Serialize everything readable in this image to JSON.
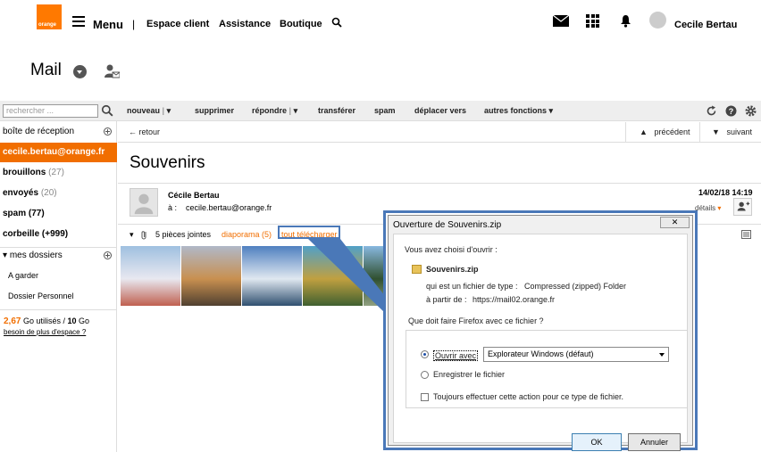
{
  "header": {
    "logo_text": "orange",
    "menu_label": "Menu",
    "nav": [
      "Espace client",
      "Assistance",
      "Boutique"
    ],
    "user_name": "Cecile Bertau"
  },
  "page": {
    "title": "Mail"
  },
  "toolbar": {
    "search_placeholder": "rechercher ...",
    "actions": [
      "nouveau",
      "supprimer",
      "répondre",
      "transférer",
      "spam",
      "déplacer vers",
      "autres fonctions"
    ]
  },
  "sidebar": {
    "inbox_header": "boîte de réception",
    "account": "cecile.bertau@orange.fr",
    "folders": [
      {
        "label": "brouillons",
        "count": "(27)"
      },
      {
        "label": "envoyés",
        "count": "(20)"
      },
      {
        "label": "spam",
        "count": "(77)"
      },
      {
        "label": "corbeille",
        "count": "(+999)"
      }
    ],
    "my_folders_header": "mes dossiers",
    "my_folders": [
      "A garder",
      "Dossier Personnel"
    ],
    "storage_used": "2,67",
    "storage_text": " Go utilisés / ",
    "storage_total": "10",
    "storage_unit": " Go",
    "storage_link": "besoin de plus d'espace ?"
  },
  "subbar": {
    "back": "retour",
    "previous": "précédent",
    "next": "suivant"
  },
  "mail": {
    "subject": "Souvenirs",
    "sender": "Cécile Bertau",
    "to_label": "à :",
    "to": "cecile.bertau@orange.fr",
    "date": "14/02/18 14:19",
    "details": "détails",
    "attachments_count": "5 pièces jointes",
    "slideshow": "diaporama (5)",
    "download_all": "tout télécharger"
  },
  "thumbnails": [
    {
      "name": "winter-mountain",
      "colors": [
        "#9fc0e0",
        "#e8e8f0",
        "#c06050"
      ]
    },
    {
      "name": "mountain-lake",
      "colors": [
        "#b0b8c8",
        "#c89050",
        "#504030"
      ]
    },
    {
      "name": "coast-cliffs",
      "colors": [
        "#4f80c0",
        "#e0e8f0",
        "#305070"
      ]
    },
    {
      "name": "wetland",
      "colors": [
        "#50a0c8",
        "#c0a040",
        "#406030"
      ]
    },
    {
      "name": "forest-lake",
      "colors": [
        "#88b8e0",
        "#305030",
        "#90a080"
      ]
    }
  ],
  "dialog": {
    "title": "Ouverture de Souvenirs.zip",
    "close": "✕",
    "intro": "Vous avez choisi d'ouvrir :",
    "filename": "Souvenirs.zip",
    "type_label": "qui est un fichier de type :",
    "type_value": "Compressed (zipped) Folder",
    "from_label": "à partir de :",
    "from_value": "https://mail02.orange.fr",
    "question": "Que doit faire Firefox avec ce fichier ?",
    "open_with": "Ouvrir avec",
    "open_with_app": "Explorateur Windows (défaut)",
    "save_file": "Enregistrer le fichier",
    "always": "Toujours effectuer cette action pour ce type de fichier.",
    "ok": "OK",
    "cancel": "Annuler"
  },
  "colors": {
    "brand": "#ff7900",
    "active": "#f16e00",
    "link": "#f16e00",
    "callout": "#4a78b8"
  }
}
